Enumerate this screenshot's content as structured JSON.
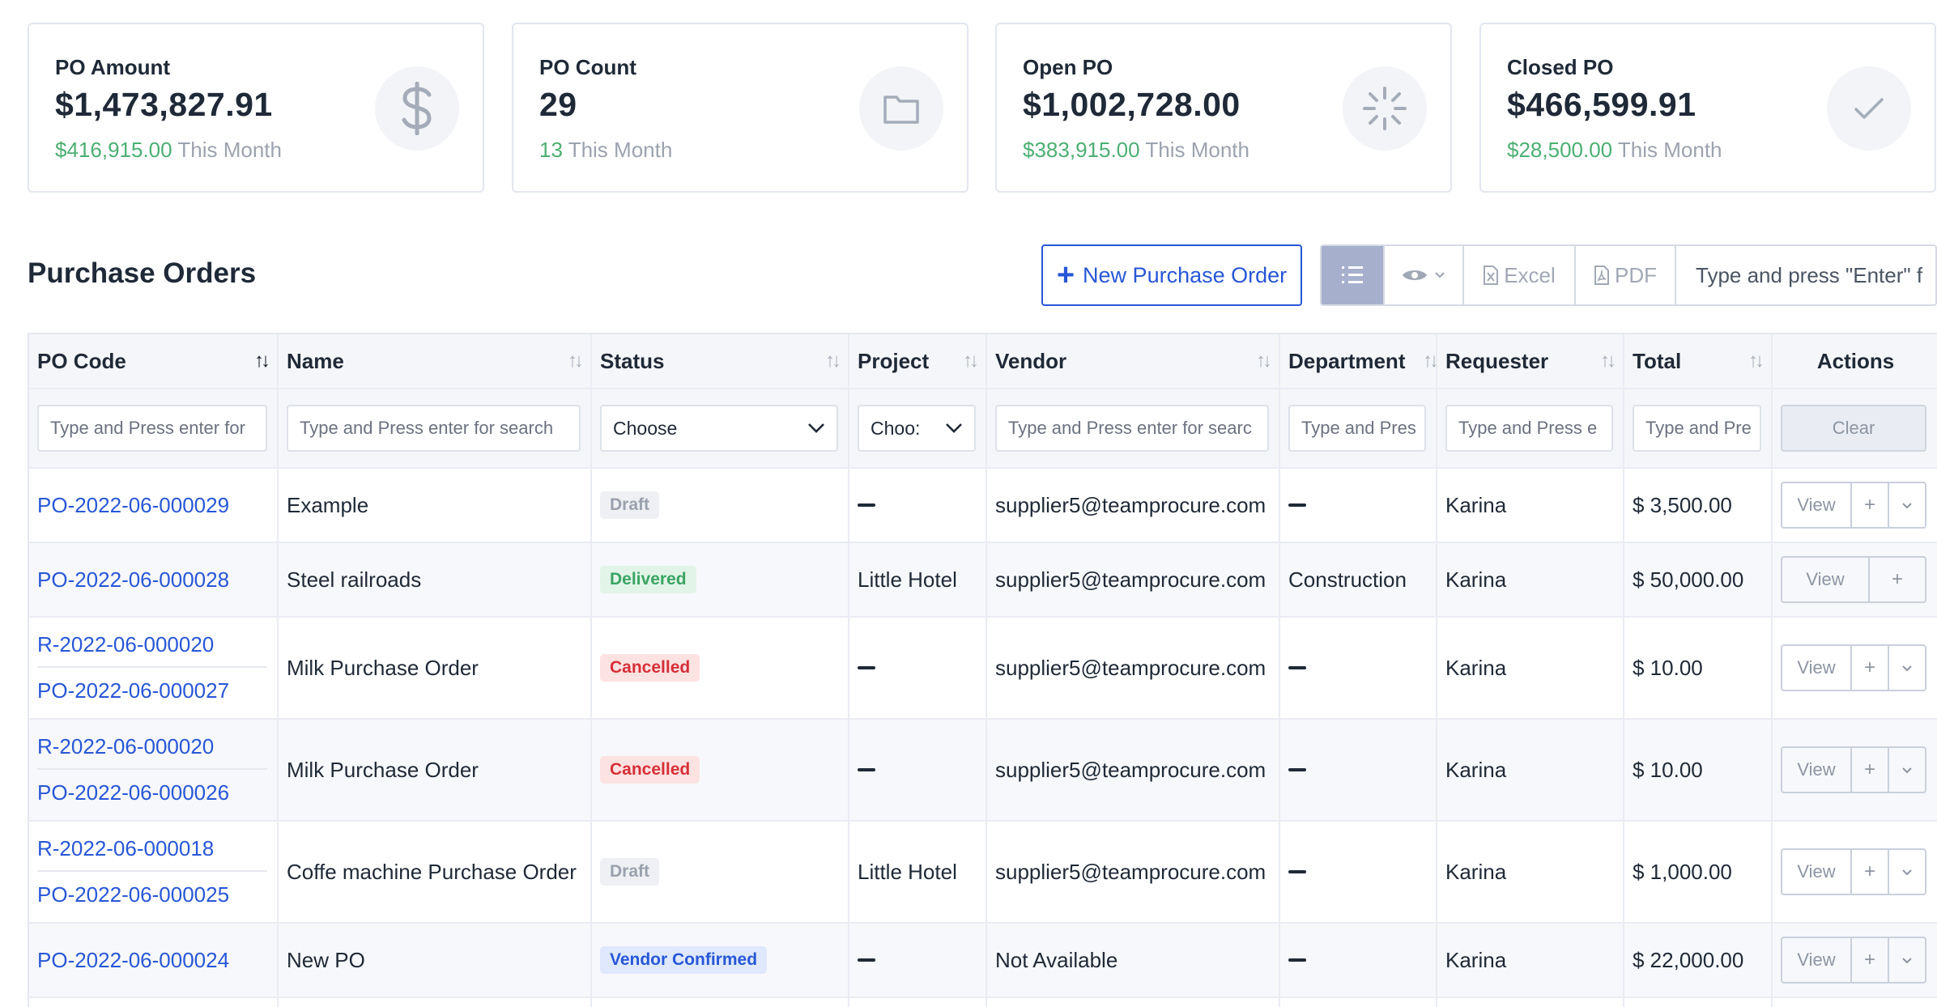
{
  "cards": [
    {
      "label": "PO Amount",
      "value": "$1,473,827.91",
      "month_value": "$416,915.00",
      "month_suffix": "This Month",
      "icon": "dollar-icon"
    },
    {
      "label": "PO Count",
      "value": "29",
      "month_value": "13",
      "month_suffix": "This Month",
      "icon": "folder-icon"
    },
    {
      "label": "Open PO",
      "value": "$1,002,728.00",
      "month_value": "$383,915.00",
      "month_suffix": "This Month",
      "icon": "spinner-icon"
    },
    {
      "label": "Closed PO",
      "value": "$466,599.91",
      "month_value": "$28,500.00",
      "month_suffix": "This Month",
      "icon": "check-icon"
    }
  ],
  "page": {
    "title": "Purchase Orders"
  },
  "toolbar": {
    "new_button": "New Purchase Order",
    "excel": "Excel",
    "pdf": "PDF",
    "search_placeholder": "Type and press \"Enter\" f"
  },
  "columns": [
    "PO Code",
    "Name",
    "Status",
    "Project",
    "Vendor",
    "Department",
    "Requester",
    "Total",
    "Actions"
  ],
  "filters": {
    "po_code": "Type and Press enter for",
    "name": "Type and Press enter for search",
    "status": "Choose",
    "project": "Choo:",
    "vendor": "Type and Press enter for searc",
    "department": "Type and Pres",
    "requester": "Type and Press e",
    "total": "Type and Pre",
    "clear": "Clear"
  },
  "actions": {
    "view": "View",
    "plus": "+"
  },
  "rows": [
    {
      "req": "",
      "po": "PO-2022-06-000029",
      "name": "Example",
      "status": "Draft",
      "project": "",
      "vendor": "supplier5@teamprocure.com",
      "department": "",
      "requester": "Karina",
      "total": "$ 3,500.00"
    },
    {
      "req": "",
      "po": "PO-2022-06-000028",
      "name": "Steel railroads",
      "status": "Delivered",
      "project": "Little Hotel",
      "vendor": "supplier5@teamprocure.com",
      "department": "Construction",
      "requester": "Karina",
      "total": "$ 50,000.00"
    },
    {
      "req": "R-2022-06-000020",
      "po": "PO-2022-06-000027",
      "name": "Milk Purchase Order",
      "status": "Cancelled",
      "project": "",
      "vendor": "supplier5@teamprocure.com",
      "department": "",
      "requester": "Karina",
      "total": "$ 10.00"
    },
    {
      "req": "R-2022-06-000020",
      "po": "PO-2022-06-000026",
      "name": "Milk Purchase Order",
      "status": "Cancelled",
      "project": "",
      "vendor": "supplier5@teamprocure.com",
      "department": "",
      "requester": "Karina",
      "total": "$ 10.00"
    },
    {
      "req": "R-2022-06-000018",
      "po": "PO-2022-06-000025",
      "name": "Coffe machine Purchase Order",
      "status": "Draft",
      "project": "Little Hotel",
      "vendor": "supplier5@teamprocure.com",
      "department": "",
      "requester": "Karina",
      "total": "$ 1,000.00"
    },
    {
      "req": "",
      "po": "PO-2022-06-000024",
      "name": "New PO",
      "status": "Vendor Confirmed",
      "project": "",
      "vendor": "Not Available",
      "department": "",
      "requester": "Karina",
      "total": "$ 22,000.00"
    }
  ],
  "colors": {
    "accent": "#2857d6",
    "positive": "#4caf72",
    "draft": "#9aa1ad",
    "delivered": "#3aa463",
    "cancelled": "#d62f38"
  }
}
